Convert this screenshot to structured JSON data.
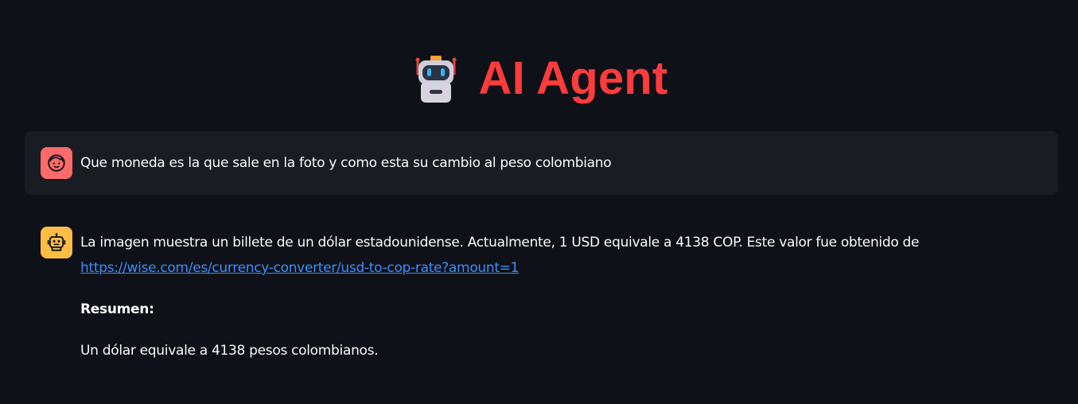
{
  "header": {
    "title": "AI Agent",
    "title_color": "#ff3b3b",
    "emoji": "robot-face-icon"
  },
  "theme": {
    "background": "#0e1117",
    "user_message_background": "#1a1c24",
    "user_avatar_color": "#ff6a6a",
    "assistant_avatar_color": "#ffbd45",
    "link_color": "#3d8fff",
    "text_color": "#fafafa"
  },
  "messages": [
    {
      "role": "user",
      "avatar_icon": "user-face-icon",
      "text": "Que moneda es la que sale en la foto y como esta su cambio al peso colombiano"
    },
    {
      "role": "assistant",
      "avatar_icon": "bot-icon",
      "text_intro": "La imagen muestra un billete de un dólar estadounidense. Actualmente, 1 USD equivale a 4138 COP. Este valor fue obtenido de",
      "link": "https://wise.com/es/currency-converter/usd-to-cop-rate?amount=1",
      "summary_heading": "Resumen:",
      "summary_text": "Un dólar equivale a 4138 pesos colombianos."
    }
  ]
}
